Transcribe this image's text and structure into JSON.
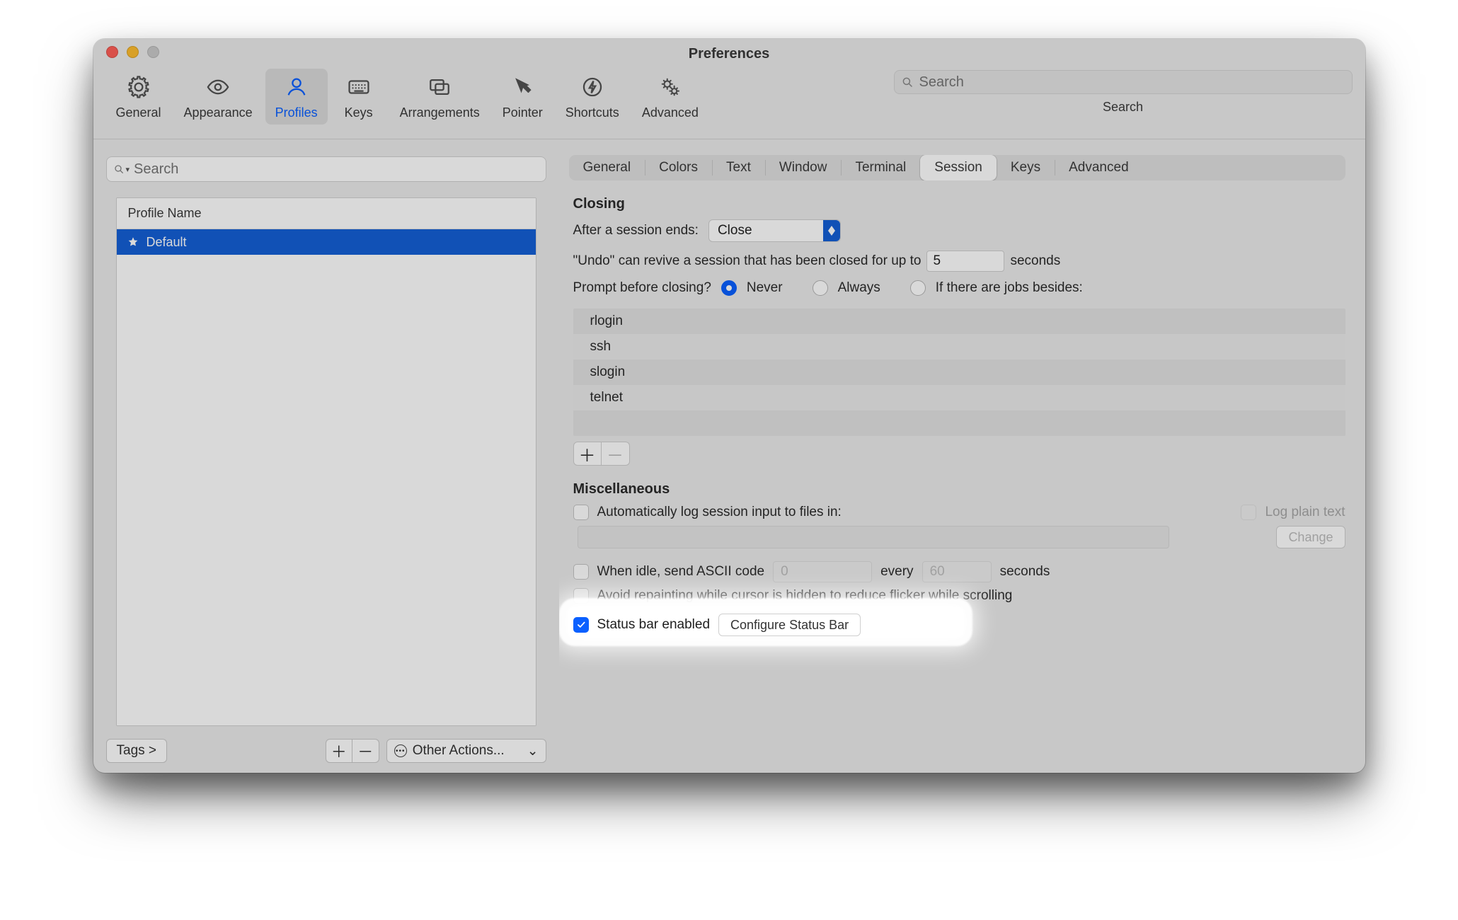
{
  "window": {
    "title": "Preferences"
  },
  "toolbar": {
    "items": [
      {
        "name": "general",
        "label": "General",
        "icon": "gear-icon"
      },
      {
        "name": "appearance",
        "label": "Appearance",
        "icon": "eye-icon"
      },
      {
        "name": "profiles",
        "label": "Profiles",
        "icon": "person-icon",
        "selected": true
      },
      {
        "name": "keys",
        "label": "Keys",
        "icon": "keyboard-icon"
      },
      {
        "name": "arrangements",
        "label": "Arrangements",
        "icon": "windows-icon"
      },
      {
        "name": "pointer",
        "label": "Pointer",
        "icon": "cursor-icon"
      },
      {
        "name": "shortcuts",
        "label": "Shortcuts",
        "icon": "bolt-icon"
      },
      {
        "name": "advanced",
        "label": "Advanced",
        "icon": "gears-icon"
      }
    ],
    "search_placeholder": "Search",
    "search_caption": "Search"
  },
  "profiles": {
    "search_placeholder": "Search",
    "header": "Profile Name",
    "rows": [
      {
        "label": "Default",
        "starred": true,
        "selected": true
      }
    ],
    "footer": {
      "tags_label": "Tags >",
      "other_actions_label": "Other Actions..."
    }
  },
  "profile_tabs": [
    "General",
    "Colors",
    "Text",
    "Window",
    "Terminal",
    "Session",
    "Keys",
    "Advanced"
  ],
  "profile_tab_active": "Session",
  "closing": {
    "heading": "Closing",
    "after_label": "After a session ends:",
    "after_value": "Close",
    "undo_pre": "\"Undo\" can revive a session that has been closed for up to",
    "undo_value": "5",
    "undo_post": "seconds",
    "prompt_label": "Prompt before closing?",
    "options": [
      "Never",
      "Always",
      "If there are jobs besides:"
    ],
    "selected_option": "Never",
    "jobs": [
      "rlogin",
      "ssh",
      "slogin",
      "telnet"
    ]
  },
  "misc": {
    "heading": "Miscellaneous",
    "auto_log_label": "Automatically log session input to files in:",
    "log_plain_label": "Log plain text",
    "change_label": "Change",
    "idle_pre": "When idle, send ASCII code",
    "idle_code": "0",
    "idle_mid": "every",
    "idle_sec": "60",
    "idle_post": "seconds",
    "avoid_repaint_label": "Avoid repainting while cursor is hidden to reduce flicker while scrolling",
    "status_bar_label": "Status bar enabled",
    "status_bar_checked": true,
    "configure_label": "Configure Status Bar"
  }
}
